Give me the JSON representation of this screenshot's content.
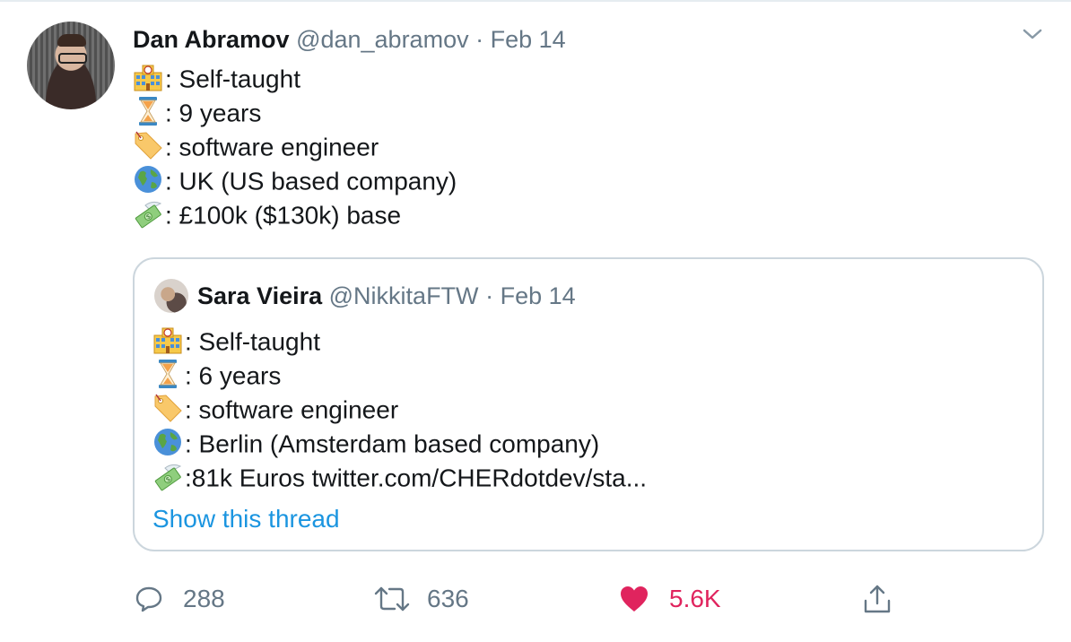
{
  "tweet": {
    "author_name": "Dan Abramov",
    "author_handle": "@dan_abramov",
    "separator": "·",
    "date": "Feb 14",
    "lines": [
      {
        "emoji": "school-icon",
        "text": ": Self-taught"
      },
      {
        "emoji": "hourglass-icon",
        "text": ": 9 years"
      },
      {
        "emoji": "label-tag-icon",
        "text": ": software engineer"
      },
      {
        "emoji": "globe-icon",
        "text": ": UK (US based company)"
      },
      {
        "emoji": "money-wings-icon",
        "text": ": £100k ($130k) base"
      }
    ]
  },
  "quoted": {
    "author_name": "Sara Vieira",
    "author_handle": "@NikkitaFTW",
    "separator": "·",
    "date": "Feb 14",
    "lines": [
      {
        "emoji": "school-icon",
        "text": ": Self-taught"
      },
      {
        "emoji": "hourglass-icon",
        "text": ": 6 years"
      },
      {
        "emoji": "label-tag-icon",
        "text": ": software engineer"
      },
      {
        "emoji": "globe-icon",
        "text": ": Berlin (Amsterdam based company)"
      },
      {
        "emoji": "money-wings-icon",
        "text": ":81k Euros twitter.com/CHERdotdev/sta..."
      }
    ],
    "show_thread": "Show this thread"
  },
  "actions": {
    "reply_count": "288",
    "retweet_count": "636",
    "like_count": "5.6K"
  },
  "colors": {
    "text": "#14171a",
    "secondary": "#657786",
    "link": "#1b95e0",
    "like": "#e0245e",
    "border": "#ccd6dd"
  }
}
